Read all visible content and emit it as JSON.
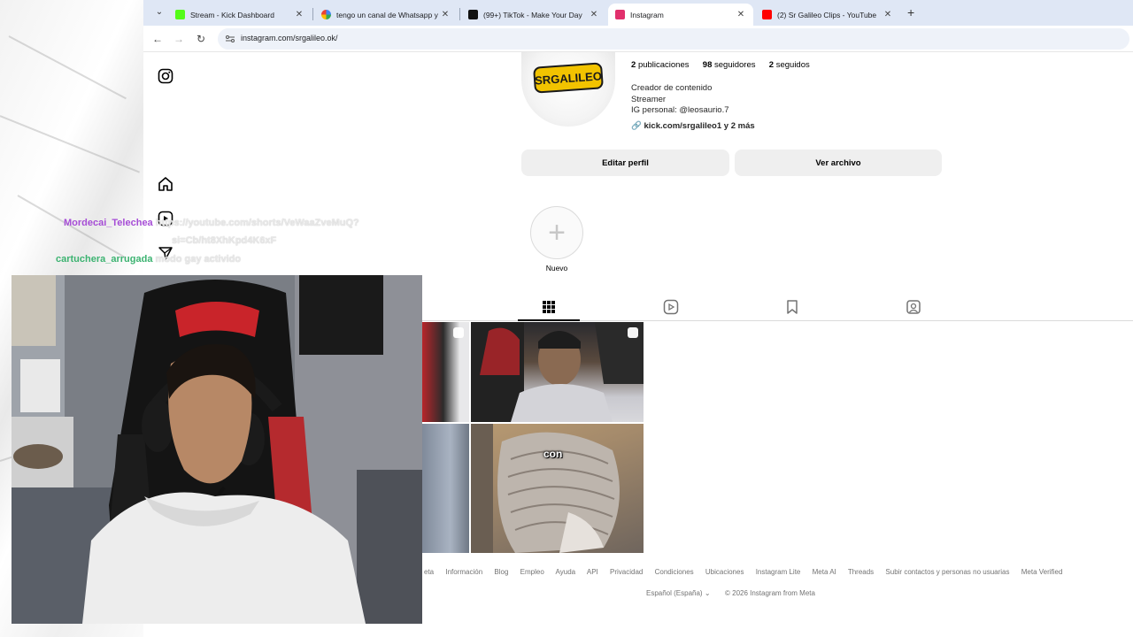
{
  "browser": {
    "tabs": [
      {
        "title": "Stream - Kick Dashboard",
        "favicon_color": "#53fc18",
        "active": false
      },
      {
        "title": "tengo un canal de Whatsapp y",
        "favicon_color": "#4285f4",
        "active": false
      },
      {
        "title": "(99+) TikTok - Make Your Day",
        "favicon_color": "#111111",
        "active": false
      },
      {
        "title": "Instagram",
        "favicon_color": "#e1306c",
        "active": true
      },
      {
        "title": "(2) Sr Galileo Clips - YouTube",
        "favicon_color": "#ff0000",
        "active": false
      }
    ],
    "url": "instagram.com/srgalileo.ok/"
  },
  "profile": {
    "avatar_text": "SRGALILEO",
    "stats": {
      "posts_count": "2",
      "posts_label": "publicaciones",
      "followers_count": "98",
      "followers_label": "seguidores",
      "following_count": "2",
      "following_label": "seguidos"
    },
    "bio": [
      "Creador de contenido",
      "Streamer",
      "IG personal: @leosaurio.7"
    ],
    "link_text": "kick.com/srgalileo1 y 2 más",
    "buttons": {
      "edit": "Editar perfil",
      "archive": "Ver archivo"
    },
    "highlight_label": "Nuevo"
  },
  "grid": {
    "caption": "con"
  },
  "footer": {
    "links": [
      "eta",
      "Información",
      "Blog",
      "Empleo",
      "Ayuda",
      "API",
      "Privacidad",
      "Condiciones",
      "Ubicaciones",
      "Instagram Lite",
      "Meta AI",
      "Threads",
      "Subir contactos y personas no usuarias",
      "Meta Verified"
    ],
    "language": "Español (España)",
    "copyright": "© 2026 Instagram from Meta"
  },
  "chat": [
    {
      "user": "Mordecai_Telechea",
      "user_color": "#a64dd6",
      "message_line1": "https://youtube.com/shorts/VeWaaZveMuQ?",
      "message_line2": "si=Cb/ht8XhKpd4K6xF"
    },
    {
      "user": "cartuchera_arrugada",
      "user_color": "#3cb371",
      "message_line1": "modo gay activido",
      "message_line2": ""
    }
  ],
  "colors": {
    "accent_text": "#262626",
    "muted": "#737373",
    "button_bg": "#efefef"
  }
}
